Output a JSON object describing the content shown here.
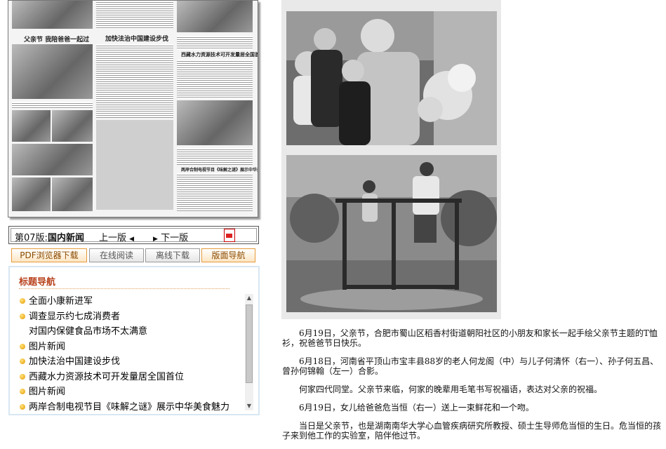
{
  "page_bar": {
    "page_label": "第07版:",
    "section_name": "国内新闻",
    "prev_label": "上一版",
    "next_label": "下一版"
  },
  "buttons": {
    "pdf_download": "PDF浏览器下载",
    "online_read": "在线阅读",
    "offline_download": "离线下载",
    "page_nav": "版面导航"
  },
  "title_nav": {
    "heading": "标题导航",
    "items": [
      "全面小康新进军",
      "调查显示约七成消费者\n对国内保健食品市场不太满意",
      "图片新闻",
      "加快法治中国建设步伐",
      "西藏水力资源技术可开发量居全国首位",
      "图片新闻",
      "两岸合制电视节目《味解之谜》展示中华美食魅力"
    ]
  },
  "paper_thumbnail": {
    "headlines": [
      "父亲节 我陪爸爸一起过",
      "加快法治中国建设步伐",
      "西藏水力资源技术可开发量居全国首位",
      "两岸合制电视节目《味解之谜》展示中华美食魅力"
    ]
  },
  "article": {
    "paragraphs": [
      "6月19日，父亲节，合肥市蜀山区稻香村街道朝阳社区的小朋友和家长一起手绘父亲节主题的T恤衫，祝爸爸节日快乐。",
      "6月18日，河南省平顶山市宝丰县88岁的老人何龙阁（中）与儿子何清怀（右一）、孙子何五昌、曾孙何锦翰（左一）合影。",
      "何家四代同堂。父亲节来临，何家的晚辈用毛笔书写祝福语，表达对父亲的祝福。",
      "6月19日，女儿给爸爸危当恒（右一）送上一束鲜花和一个吻。",
      "当日是父亲节，也是湖南南华大学心血管疾病研究所教授、硕士生导师危当恒的生日。危当恒的孩子来到他工作的实验室，陪伴他过节。"
    ]
  },
  "icons": {
    "pdf": "pdf-icon",
    "prev": "triangle-left-icon",
    "next": "triangle-right-icon",
    "bullet": "orange-dot-icon"
  },
  "colors": {
    "nav_heading": "#b8421d",
    "button_orange_border": "#e59a3a",
    "nav_border": "#d7e7f3"
  }
}
